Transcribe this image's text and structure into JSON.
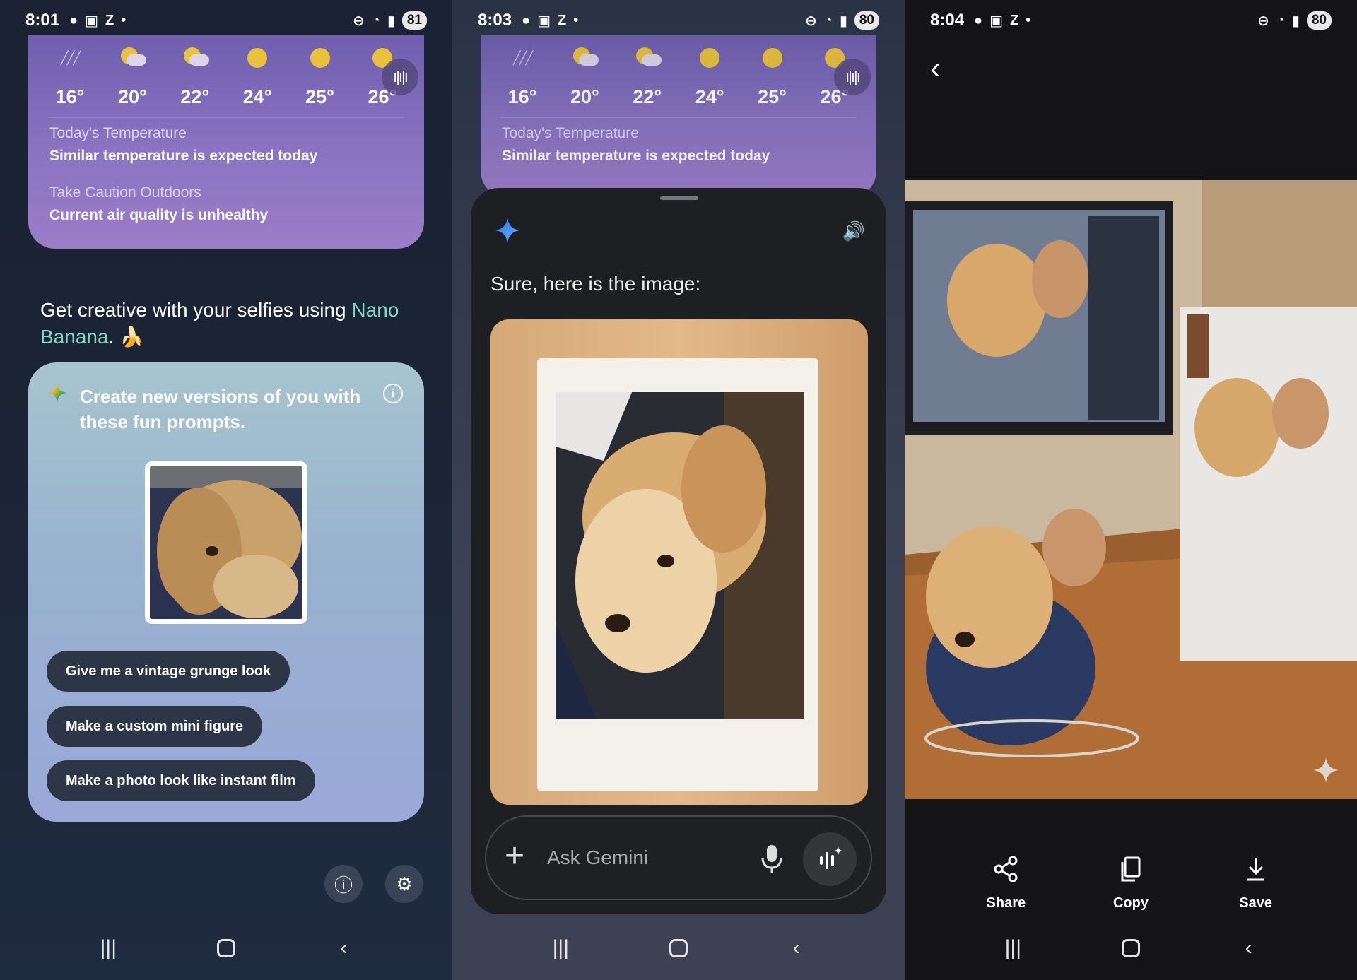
{
  "screens": [
    {
      "status": {
        "time": "8:01",
        "battery": "81"
      },
      "weather": {
        "hours": [
          {
            "temp": "16°",
            "icon": "rain-icon"
          },
          {
            "temp": "20°",
            "icon": "partly-cloudy-icon"
          },
          {
            "temp": "22°",
            "icon": "partly-cloudy-icon"
          },
          {
            "temp": "24°",
            "icon": "sun-icon"
          },
          {
            "temp": "25°",
            "icon": "sun-icon"
          },
          {
            "temp": "26°",
            "icon": "sun-icon"
          }
        ],
        "today_heading": "Today's Temperature",
        "today_text": "Similar temperature is expected today",
        "caution_heading": "Take Caution Outdoors",
        "caution_text": "Current air quality is unhealthy"
      },
      "promo": {
        "prefix": "Get creative with your selfies using ",
        "accent": "Nano Banana",
        "suffix": ". 🍌"
      },
      "prompt_card": {
        "title": "Create new versions of you with these fun prompts.",
        "chips": [
          "Give me a vintage grunge look",
          "Make a custom mini figure",
          "Make a photo look like instant film"
        ]
      }
    },
    {
      "status": {
        "time": "8:03",
        "battery": "80"
      },
      "weather": {
        "hours": [
          {
            "temp": "16°",
            "icon": "rain-icon"
          },
          {
            "temp": "20°",
            "icon": "partly-cloudy-icon"
          },
          {
            "temp": "22°",
            "icon": "partly-cloudy-icon"
          },
          {
            "temp": "24°",
            "icon": "sun-icon"
          },
          {
            "temp": "25°",
            "icon": "sun-icon"
          },
          {
            "temp": "26°",
            "icon": "sun-icon"
          }
        ],
        "today_heading": "Today's Temperature",
        "today_text": "Similar temperature is expected today"
      },
      "reply": "Sure, here is the image:",
      "input_placeholder": "Ask Gemini"
    },
    {
      "status": {
        "time": "8:04",
        "battery": "80"
      },
      "actions": [
        "Share",
        "Copy",
        "Save"
      ]
    }
  ],
  "colors": {
    "accent_teal": "#7fd8c8",
    "gemini_blue": "#4a8ff7",
    "weather_purple": "#8a74c2"
  }
}
